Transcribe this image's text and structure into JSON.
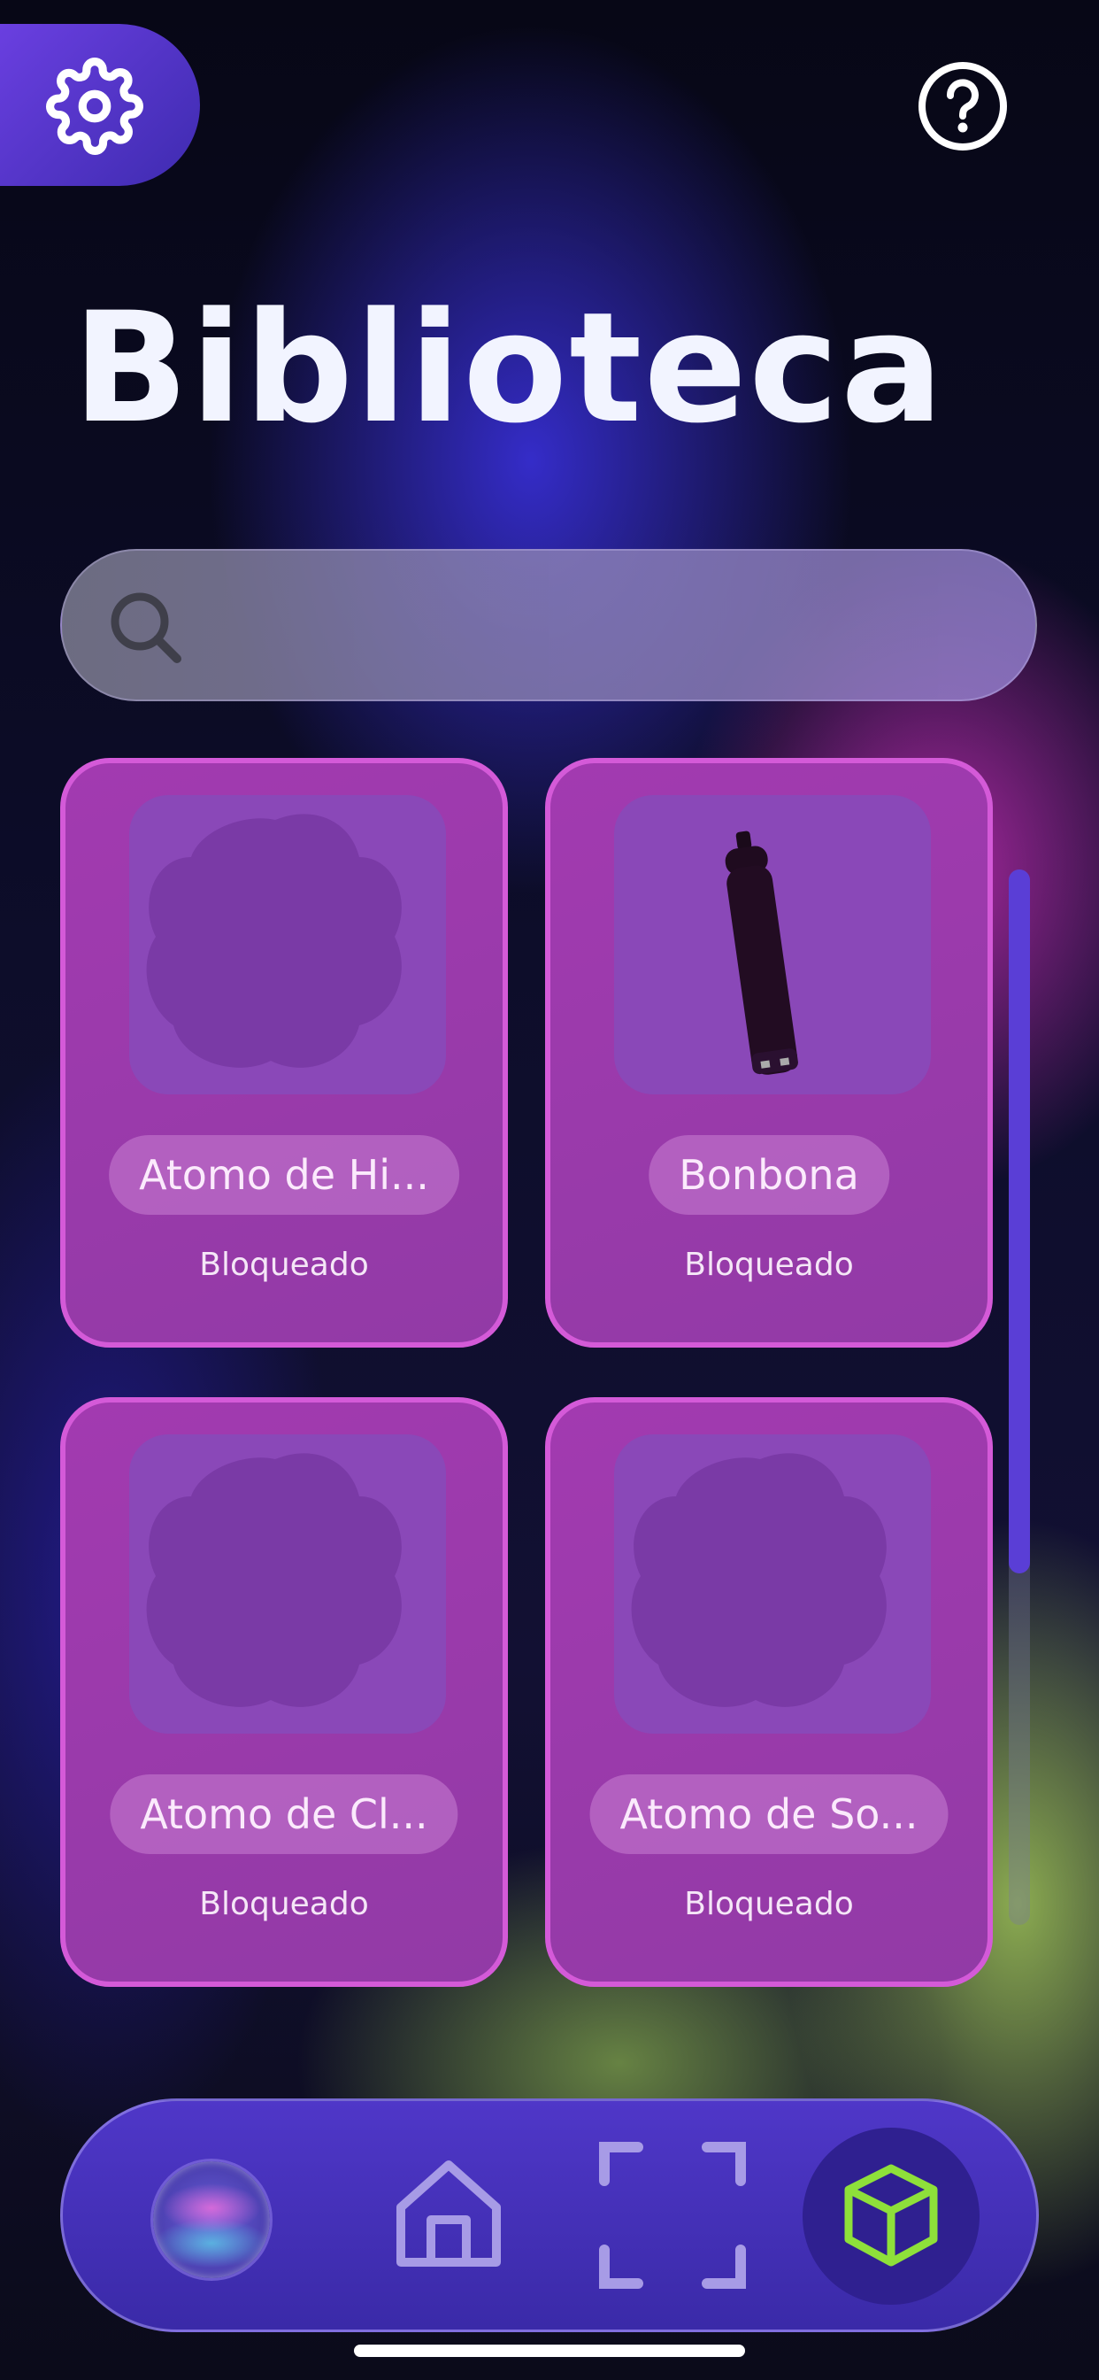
{
  "header": {
    "settings_icon": "gear-icon",
    "help_icon": "question-circle-icon",
    "title": "Biblioteca"
  },
  "search": {
    "icon": "search-icon",
    "placeholder": "",
    "value": ""
  },
  "library": {
    "items": [
      {
        "name": "Atomo de Hi...",
        "status": "Bloqueado",
        "thumbnail": "locked-blob"
      },
      {
        "name": "Bonbona",
        "status": "Bloqueado",
        "thumbnail": "gas-cylinder"
      },
      {
        "name": "Atomo de Cl...",
        "status": "Bloqueado",
        "thumbnail": "locked-blob"
      },
      {
        "name": "Atomo de So...",
        "status": "Bloqueado",
        "thumbnail": "locked-blob"
      }
    ]
  },
  "scrollbar": {
    "position": 0.0,
    "visible_fraction": 0.67
  },
  "bottom_nav": {
    "items": [
      {
        "icon": "profile-orb-icon",
        "active": false
      },
      {
        "icon": "home-icon",
        "active": false
      },
      {
        "icon": "scan-frame-icon",
        "active": false
      },
      {
        "icon": "cube-icon",
        "active": true
      }
    ]
  },
  "colors": {
    "card_background": "#9a3aab",
    "card_border": "#d45ad8",
    "active_nav": "#8ee03a",
    "nav_background": "#4530b8"
  }
}
